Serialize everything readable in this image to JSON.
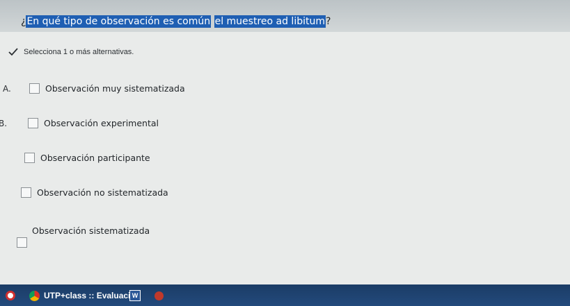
{
  "question": {
    "prefix": "¿",
    "highlight_1": "En qué tipo de observación es común",
    "highlight_2": "el muestreo ad libitum",
    "suffix": "?"
  },
  "instruction": "Selecciona 1 o más alternativas.",
  "options": [
    {
      "letter": "A.",
      "label": "Observación muy sistematizada"
    },
    {
      "letter": "B.",
      "label": "Observación experimental"
    },
    {
      "letter": "",
      "label": "Observación participante"
    },
    {
      "letter": "",
      "label": "Observación no sistematizada"
    },
    {
      "letter": "",
      "label": "Observación sistematizada"
    }
  ],
  "taskbar": {
    "window_title": "UTP+class :: Evaluaci...",
    "word_icon_letter": "W"
  },
  "colors": {
    "highlight": "#1f5fb3",
    "taskbar": "#1b3c66"
  }
}
